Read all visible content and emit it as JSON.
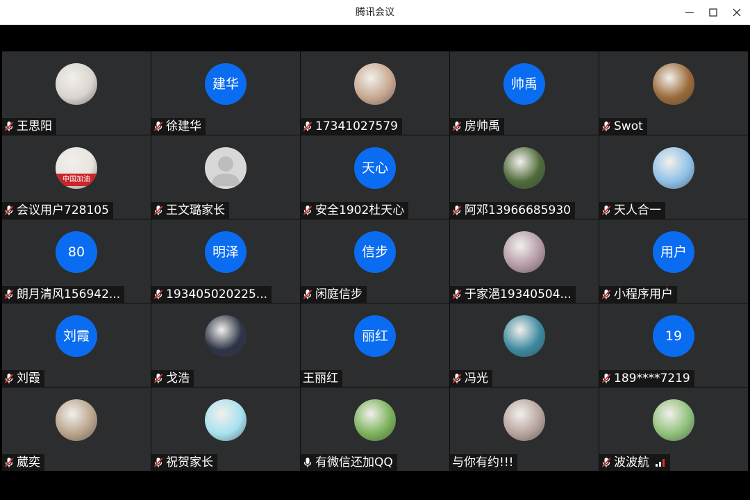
{
  "window": {
    "title": "腾讯会议"
  },
  "participants": [
    {
      "name": "王思阳",
      "avatar": "photo",
      "mic": "muted",
      "avatar_bg": "#d9d4cf"
    },
    {
      "name": "徐建华",
      "avatar": "initials",
      "initials": "建华",
      "mic": "muted"
    },
    {
      "name": "17341027579",
      "avatar": "photo",
      "mic": "muted",
      "avatar_bg": "#c8a890"
    },
    {
      "name": "房帅禹",
      "avatar": "initials",
      "initials": "帅禹",
      "mic": "muted"
    },
    {
      "name": "Swot",
      "avatar": "photo",
      "mic": "muted",
      "avatar_bg": "#9a6a3a"
    },
    {
      "name": "会议用户728105",
      "avatar": "photo",
      "mic": "muted",
      "avatar_bg": "#e8e4de",
      "avatar_caption": "中国加油"
    },
    {
      "name": "王文璐家长",
      "avatar": "default",
      "mic": "muted",
      "avatar_bg": "#d8d8d8"
    },
    {
      "name": "安全1902杜天心",
      "avatar": "initials",
      "initials": "天心",
      "mic": "muted"
    },
    {
      "name": "阿邓13966685930",
      "avatar": "photo",
      "mic": "muted",
      "avatar_bg": "#4f6b3a"
    },
    {
      "name": "天人合一",
      "avatar": "photo",
      "mic": "muted",
      "avatar_bg": "#8fc1e8"
    },
    {
      "name": "朗月清风156942...",
      "avatar": "initials",
      "initials": "80",
      "mic": "muted"
    },
    {
      "name": "193405020225...",
      "avatar": "initials",
      "initials": "明泽",
      "mic": "muted"
    },
    {
      "name": "闲庭信步",
      "avatar": "initials",
      "initials": "信步",
      "mic": "muted"
    },
    {
      "name": "于家浥19340504...",
      "avatar": "photo",
      "mic": "muted",
      "avatar_bg": "#b49aa6"
    },
    {
      "name": "小程序用户",
      "avatar": "initials",
      "initials": "用户",
      "mic": "muted"
    },
    {
      "name": "刘霞",
      "avatar": "initials",
      "initials": "刘霞",
      "mic": "muted"
    },
    {
      "name": "戈浩",
      "avatar": "photo",
      "mic": "muted",
      "avatar_bg": "#2e3446"
    },
    {
      "name": "王丽红",
      "avatar": "initials",
      "initials": "丽红",
      "mic": "none"
    },
    {
      "name": "冯光",
      "avatar": "photo",
      "mic": "muted",
      "avatar_bg": "#3d8aa0"
    },
    {
      "name": "189****7219",
      "avatar": "initials",
      "initials": "19",
      "mic": "muted"
    },
    {
      "name": "葳奕",
      "avatar": "photo",
      "mic": "muted",
      "avatar_bg": "#b9a48c"
    },
    {
      "name": "祝贺家长",
      "avatar": "photo",
      "mic": "muted",
      "avatar_bg": "#a7e1ef"
    },
    {
      "name": "有微信还加QQ",
      "avatar": "photo",
      "mic": "on",
      "avatar_bg": "#7bb25a"
    },
    {
      "name": "与你有约!!!",
      "avatar": "photo",
      "mic": "none",
      "avatar_bg": "#b8a39e"
    },
    {
      "name": "波波航",
      "avatar": "photo",
      "mic": "muted",
      "signal": true,
      "avatar_bg": "#8fc07a"
    }
  ],
  "colors": {
    "tile_bg": "#2c2d2f",
    "avatar_blue": "#0a6cf0",
    "mute_red": "#e0302c"
  }
}
